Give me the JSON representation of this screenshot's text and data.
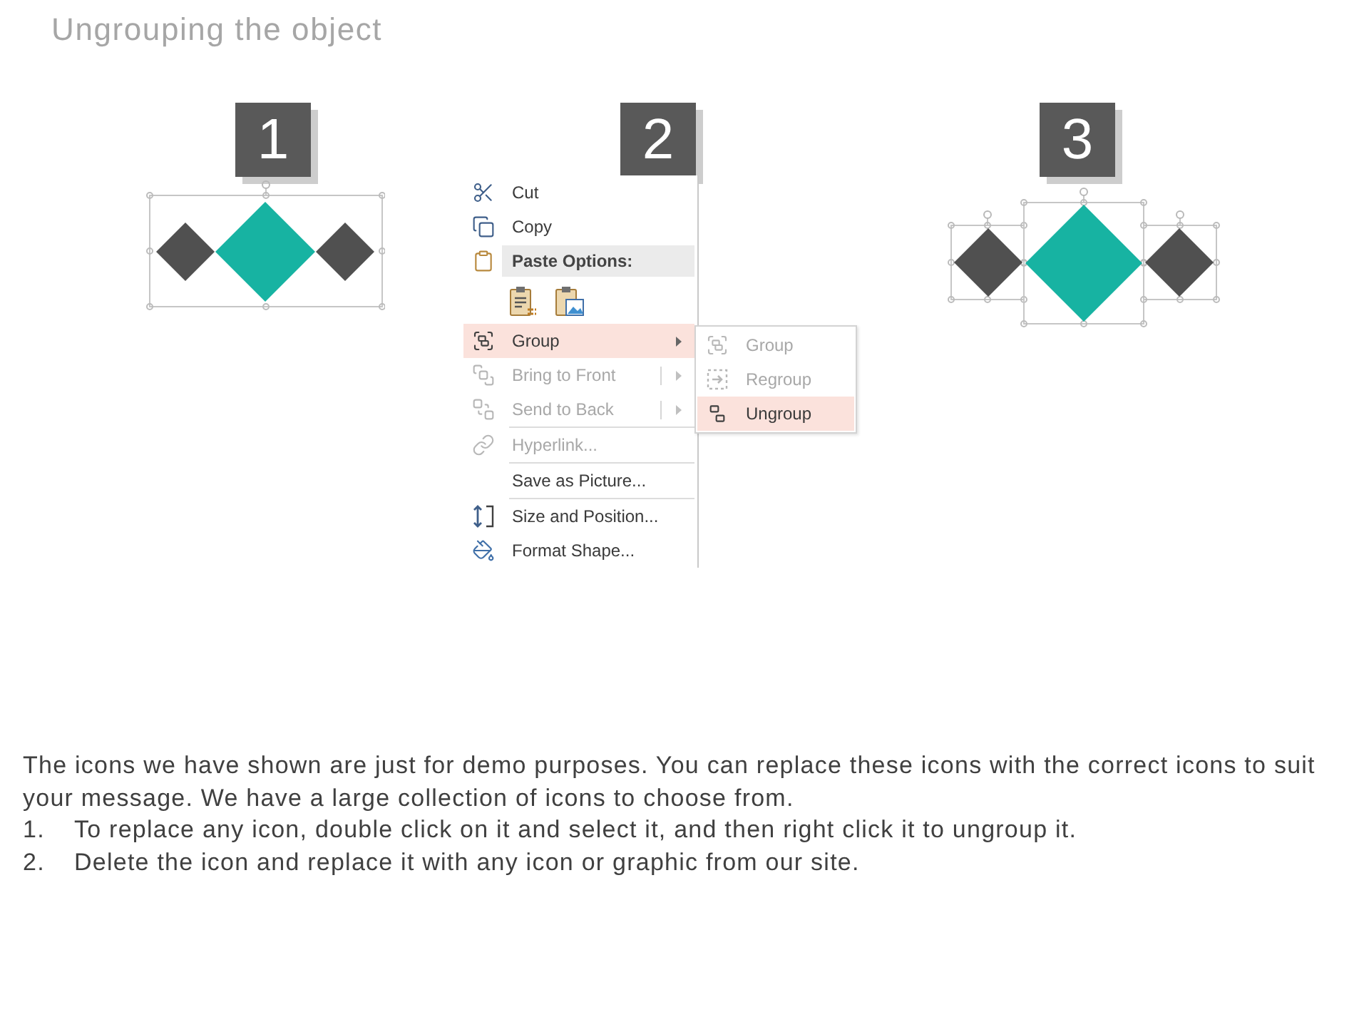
{
  "title": "Ungrouping the object",
  "steps": [
    {
      "number": "1",
      "kind": "grouped",
      "diamonds": [
        {
          "color": "#505050"
        },
        {
          "color": "#17b3a2"
        },
        {
          "color": "#505050"
        }
      ]
    },
    {
      "number": "2",
      "kind": "menu",
      "menu": {
        "items": [
          {
            "kind": "command",
            "label": "Cut",
            "disabled": false,
            "selected": false,
            "divider": false,
            "arrow": false,
            "split": false
          },
          {
            "kind": "command",
            "label": "Copy",
            "disabled": false,
            "selected": false,
            "divider": false,
            "arrow": false,
            "split": false
          },
          {
            "kind": "header",
            "label": "Paste Options:"
          },
          {
            "kind": "paste_options"
          },
          {
            "kind": "command",
            "label": "Group",
            "disabled": false,
            "selected": true,
            "divider": false,
            "arrow": true,
            "split": false,
            "submenu": [
              {
                "label": "Group",
                "disabled": true,
                "selected": false
              },
              {
                "label": "Regroup",
                "disabled": true,
                "selected": false
              },
              {
                "label": "Ungroup",
                "disabled": false,
                "selected": true
              }
            ]
          },
          {
            "kind": "command",
            "label": "Bring to Front",
            "disabled": true,
            "selected": false,
            "divider": false,
            "arrow": true,
            "split": true
          },
          {
            "kind": "command",
            "label": "Send to Back",
            "disabled": true,
            "selected": false,
            "divider": false,
            "arrow": true,
            "split": true
          },
          {
            "kind": "command",
            "label": "Hyperlink...",
            "disabled": true,
            "selected": false,
            "divider": true,
            "arrow": false,
            "split": false
          },
          {
            "kind": "command",
            "label": "Save as Picture...",
            "disabled": false,
            "selected": false,
            "divider": true,
            "arrow": false,
            "split": false
          },
          {
            "kind": "command",
            "label": "Size and Position...",
            "disabled": false,
            "selected": false,
            "divider": true,
            "arrow": false,
            "split": false
          },
          {
            "kind": "command",
            "label": "Format Shape...",
            "disabled": false,
            "selected": false,
            "divider": false,
            "arrow": false,
            "split": false
          }
        ]
      }
    },
    {
      "number": "3",
      "kind": "ungrouped",
      "diamonds": [
        {
          "color": "#505050"
        },
        {
          "color": "#17b3a2"
        },
        {
          "color": "#505050"
        }
      ]
    }
  ],
  "note": {
    "text": "The icons we have shown are just for demo purposes. You can replace these icons with the correct icons to suit your message. We have a large collection of icons to choose from.",
    "steps": [
      {
        "number": "1.",
        "text": "To replace any icon, double click on it and select it, and then right click it to ungroup it."
      },
      {
        "number": "2.",
        "text": "Delete the icon and replace it with any icon or graphic from our site."
      }
    ]
  }
}
